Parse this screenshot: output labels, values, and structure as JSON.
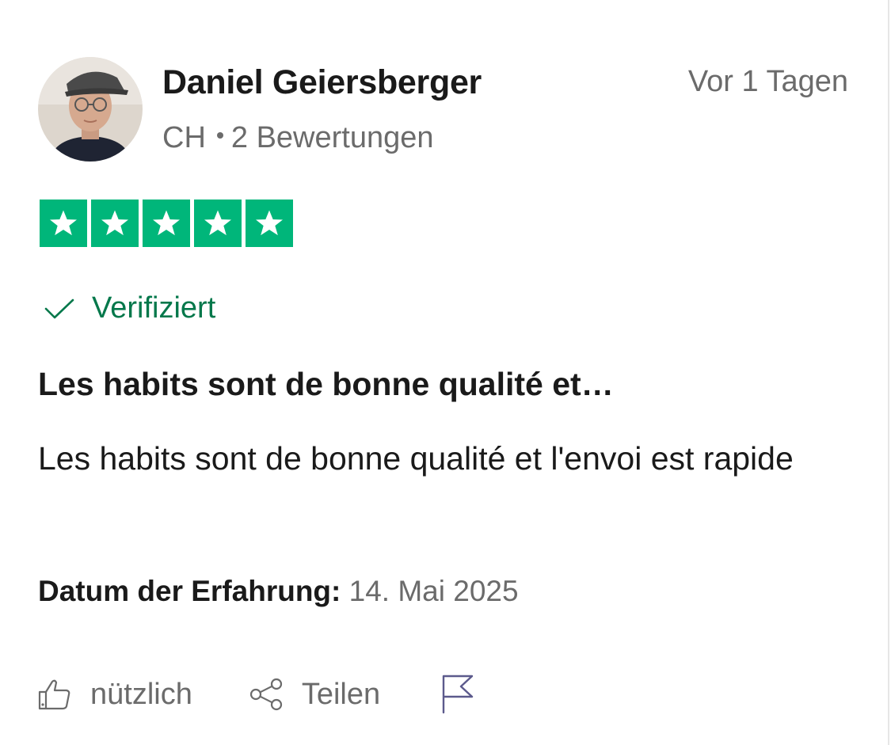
{
  "review": {
    "reviewer": {
      "name": "Daniel Geiersberger",
      "country": "CH",
      "review_count": "2 Bewertungen"
    },
    "time_ago": "Vor 1 Tagen",
    "rating": 5,
    "verified_label": "Verifiziert",
    "title": "Les habits sont de bonne qualité et…",
    "body": "Les habits sont de bonne qualité et l'envoi est rapide",
    "experience_label": "Datum der Erfahrung:",
    "experience_date": "14. Mai 2025"
  },
  "actions": {
    "useful_label": "nützlich",
    "share_label": "Teilen"
  },
  "colors": {
    "star_green": "#00b67a",
    "verified_green": "#04784b",
    "muted_text": "#6b6b6b",
    "flag_icon": "#5c5a8c"
  },
  "icons": [
    "avatar-photo",
    "star-icon",
    "check-icon",
    "thumbs-up-icon",
    "share-icon",
    "flag-icon"
  ]
}
